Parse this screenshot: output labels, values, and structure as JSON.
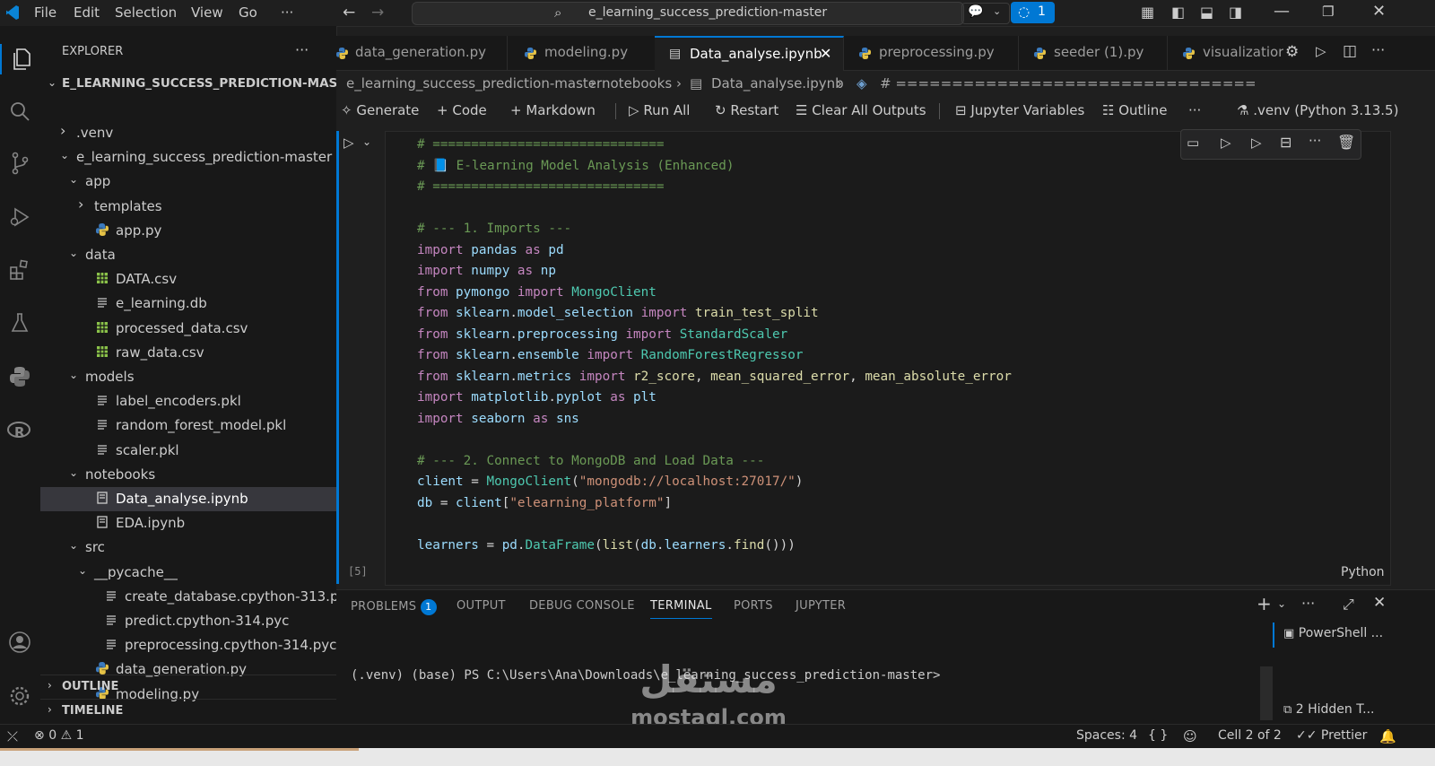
{
  "menu": [
    "File",
    "Edit",
    "Selection",
    "View",
    "Go",
    "···"
  ],
  "search": {
    "text": "e_learning_success_prediction-master"
  },
  "titlebar": {
    "copilot_count": "1"
  },
  "explorer": {
    "title": "EXPLORER",
    "root": "E_LEARNING_SUCCESS_PREDICTION-MASTER",
    "items": [
      {
        "label": ".venv",
        "depth": 1,
        "kind": "folder-closed"
      },
      {
        "label": "e_learning_success_prediction-master",
        "depth": 1,
        "kind": "folder-open"
      },
      {
        "label": "app",
        "depth": 2,
        "kind": "folder-open"
      },
      {
        "label": "templates",
        "depth": 3,
        "kind": "folder-closed"
      },
      {
        "label": "app.py",
        "depth": 3,
        "kind": "py"
      },
      {
        "label": "data",
        "depth": 2,
        "kind": "folder-open"
      },
      {
        "label": "DATA.csv",
        "depth": 3,
        "kind": "csv"
      },
      {
        "label": "e_learning.db",
        "depth": 3,
        "kind": "file"
      },
      {
        "label": "processed_data.csv",
        "depth": 3,
        "kind": "csv"
      },
      {
        "label": "raw_data.csv",
        "depth": 3,
        "kind": "csv"
      },
      {
        "label": "models",
        "depth": 2,
        "kind": "folder-open"
      },
      {
        "label": "label_encoders.pkl",
        "depth": 3,
        "kind": "file"
      },
      {
        "label": "random_forest_model.pkl",
        "depth": 3,
        "kind": "file"
      },
      {
        "label": "scaler.pkl",
        "depth": 3,
        "kind": "file"
      },
      {
        "label": "notebooks",
        "depth": 2,
        "kind": "folder-open"
      },
      {
        "label": "Data_analyse.ipynb",
        "depth": 3,
        "kind": "nb",
        "selected": true
      },
      {
        "label": "EDA.ipynb",
        "depth": 3,
        "kind": "nb"
      },
      {
        "label": "src",
        "depth": 2,
        "kind": "folder-open"
      },
      {
        "label": "__pycache__",
        "depth": 3,
        "kind": "folder-open"
      },
      {
        "label": "create_database.cpython-313.pyc",
        "depth": 4,
        "kind": "file"
      },
      {
        "label": "predict.cpython-314.pyc",
        "depth": 4,
        "kind": "file"
      },
      {
        "label": "preprocessing.cpython-314.pyc",
        "depth": 4,
        "kind": "file"
      },
      {
        "label": "data_generation.py",
        "depth": 3,
        "kind": "py"
      },
      {
        "label": "modeling.py",
        "depth": 3,
        "kind": "py"
      }
    ],
    "outline": "OUTLINE",
    "timeline": "TIMELINE"
  },
  "tabs": [
    {
      "label": "data_generation.py"
    },
    {
      "label": "modeling.py"
    },
    {
      "label": "Data_analyse.ipynb",
      "active": true
    },
    {
      "label": "preprocessing.py"
    },
    {
      "label": "seeder (1).py"
    },
    {
      "label": "visualizatior"
    }
  ],
  "breadcrumb": [
    "e_learning_success_prediction-master",
    "notebooks",
    "Data_analyse.ipynb",
    "# ================================"
  ],
  "nbtoolbar": {
    "generate": "Generate",
    "code": "Code",
    "markdown": "Markdown",
    "run_all": "Run All",
    "restart": "Restart",
    "clear": "Clear All Outputs",
    "variables": "Jupyter Variables",
    "outline": "Outline",
    "more": "···",
    "kernel": ".venv (Python 3.13.5)"
  },
  "cell": {
    "exec_count": "[5]",
    "language": "Python",
    "lines": [
      "# ==============================",
      "# 📘 E-learning Model Analysis (Enhanced)",
      "# ==============================",
      "",
      "# --- 1. Imports ---",
      "import pandas as pd",
      "import numpy as np",
      "from pymongo import MongoClient",
      "from sklearn.model_selection import train_test_split",
      "from sklearn.preprocessing import StandardScaler",
      "from sklearn.ensemble import RandomForestRegressor",
      "from sklearn.metrics import r2_score, mean_squared_error, mean_absolute_error",
      "import matplotlib.pyplot as plt",
      "import seaborn as sns",
      "",
      "# --- 2. Connect to MongoDB and Load Data ---",
      "client = MongoClient(\"mongodb://localhost:27017/\")",
      "db = client[\"elearning_platform\"]",
      "",
      "learners = pd.DataFrame(list(db.learners.find()))"
    ]
  },
  "panel": {
    "tabs": [
      "PROBLEMS",
      "OUTPUT",
      "DEBUG CONSOLE",
      "TERMINAL",
      "PORTS",
      "JUPYTER"
    ],
    "problems_count": "1",
    "active_tab": "TERMINAL",
    "terminal_line": "(.venv) (base) PS C:\\Users\\Ana\\Downloads\\e_learning_success_prediction-master>",
    "powershell": "PowerShell ...",
    "hidden": "2 Hidden T..."
  },
  "statusbar": {
    "errors": "0",
    "warnings": "1",
    "spaces": "Spaces: 4",
    "braces": "{ }",
    "cell": "Cell 2 of 2",
    "prettier": "Prettier"
  },
  "watermark": {
    "arabic": "مستقل",
    "latin": "mostaql.com"
  },
  "colors": {
    "accent": "#0078d4",
    "keyword": "#c586c0",
    "comment": "#6a9955",
    "function": "#dcdcaa",
    "class": "#4ec9b0",
    "string": "#ce9178"
  }
}
